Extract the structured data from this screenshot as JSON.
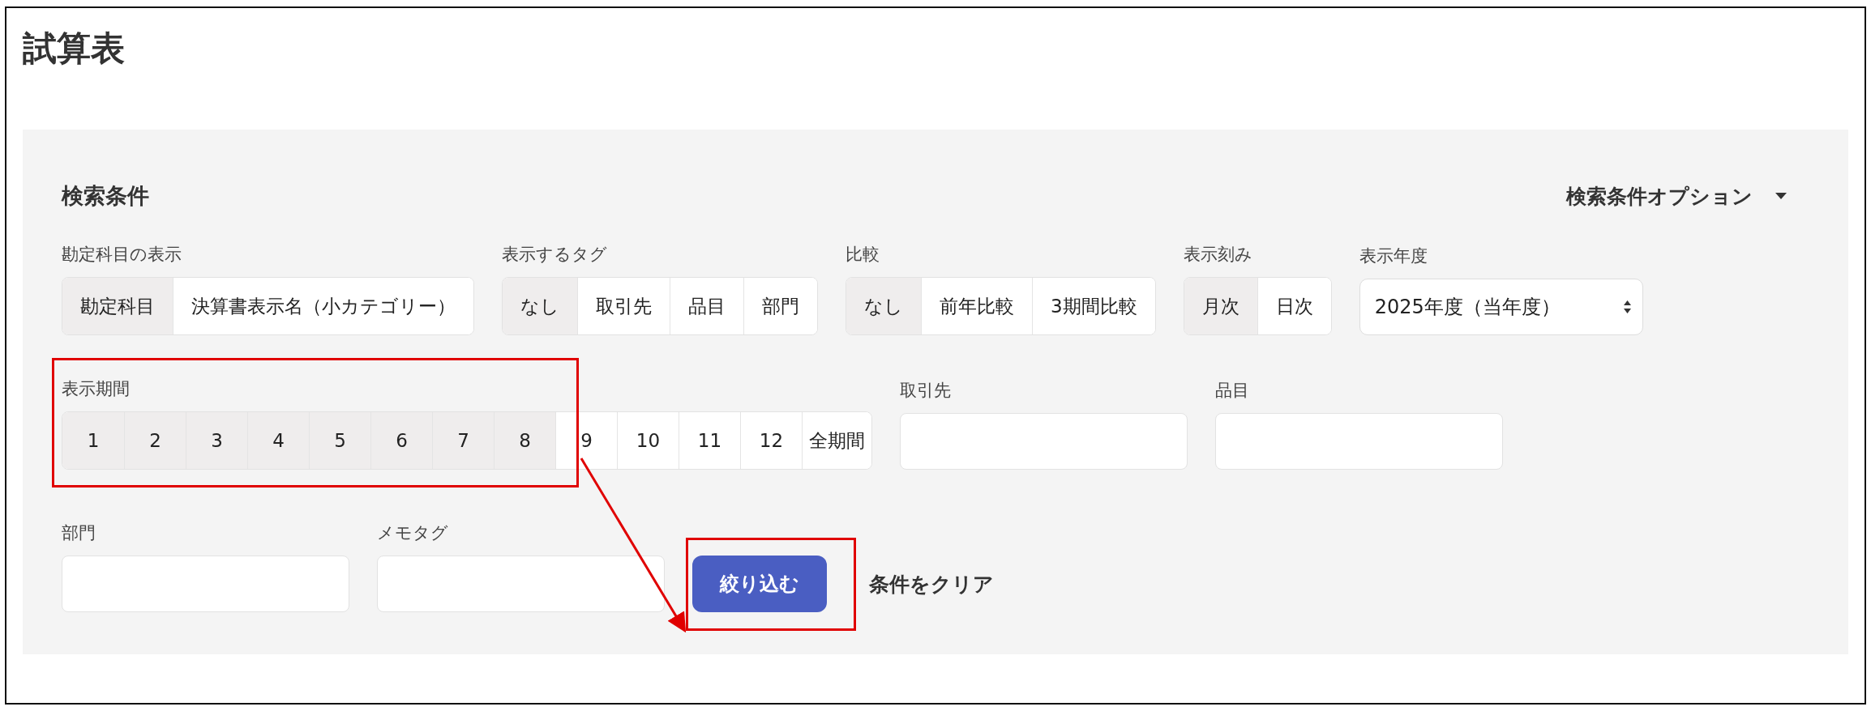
{
  "page_title": "試算表",
  "search": {
    "title": "検索条件",
    "options_toggle": {
      "label": "検索条件オプション",
      "expanded": false
    },
    "rows": [
      {
        "fields": [
          {
            "kind": "segmented",
            "label": "勘定科目の表示",
            "highlighted": false,
            "options": [
              {
                "label": "勘定科目",
                "selected": true
              },
              {
                "label": "決算書表示名（小カテゴリー）",
                "selected": false
              }
            ]
          },
          {
            "kind": "segmented",
            "label": "表示するタグ",
            "highlighted": false,
            "options": [
              {
                "label": "なし",
                "selected": true
              },
              {
                "label": "取引先",
                "selected": false
              },
              {
                "label": "品目",
                "selected": false
              },
              {
                "label": "部門",
                "selected": false
              }
            ]
          },
          {
            "kind": "segmented",
            "label": "比較",
            "highlighted": false,
            "options": [
              {
                "label": "なし",
                "selected": true
              },
              {
                "label": "前年比較",
                "selected": false
              },
              {
                "label": "3期間比較",
                "selected": false
              }
            ]
          },
          {
            "kind": "segmented",
            "label": "表示刻み",
            "highlighted": false,
            "options": [
              {
                "label": "月次",
                "selected": true
              },
              {
                "label": "日次",
                "selected": false
              }
            ]
          },
          {
            "kind": "select",
            "label": "表示年度",
            "value": "2025年度（当年度）"
          }
        ]
      },
      {
        "fields": [
          {
            "kind": "segmented",
            "label": "表示期間",
            "highlighted": true,
            "options": [
              {
                "label": "1",
                "selected": true
              },
              {
                "label": "2",
                "selected": true
              },
              {
                "label": "3",
                "selected": true
              },
              {
                "label": "4",
                "selected": true
              },
              {
                "label": "5",
                "selected": true
              },
              {
                "label": "6",
                "selected": true
              },
              {
                "label": "7",
                "selected": true
              },
              {
                "label": "8",
                "selected": true
              },
              {
                "label": "9",
                "selected": false
              },
              {
                "label": "10",
                "selected": false
              },
              {
                "label": "11",
                "selected": false
              },
              {
                "label": "12",
                "selected": false
              },
              {
                "label": "全期間",
                "selected": false
              }
            ]
          },
          {
            "kind": "text",
            "label": "取引先"
          },
          {
            "kind": "text",
            "label": "品目"
          }
        ]
      },
      {
        "fields": [
          {
            "kind": "text",
            "label": "部門"
          },
          {
            "kind": "text",
            "label": "メモタグ"
          },
          {
            "kind": "primary_button",
            "label": "絞り込む",
            "highlighted": true
          },
          {
            "kind": "link_button",
            "label": "条件をクリア"
          }
        ]
      }
    ]
  }
}
